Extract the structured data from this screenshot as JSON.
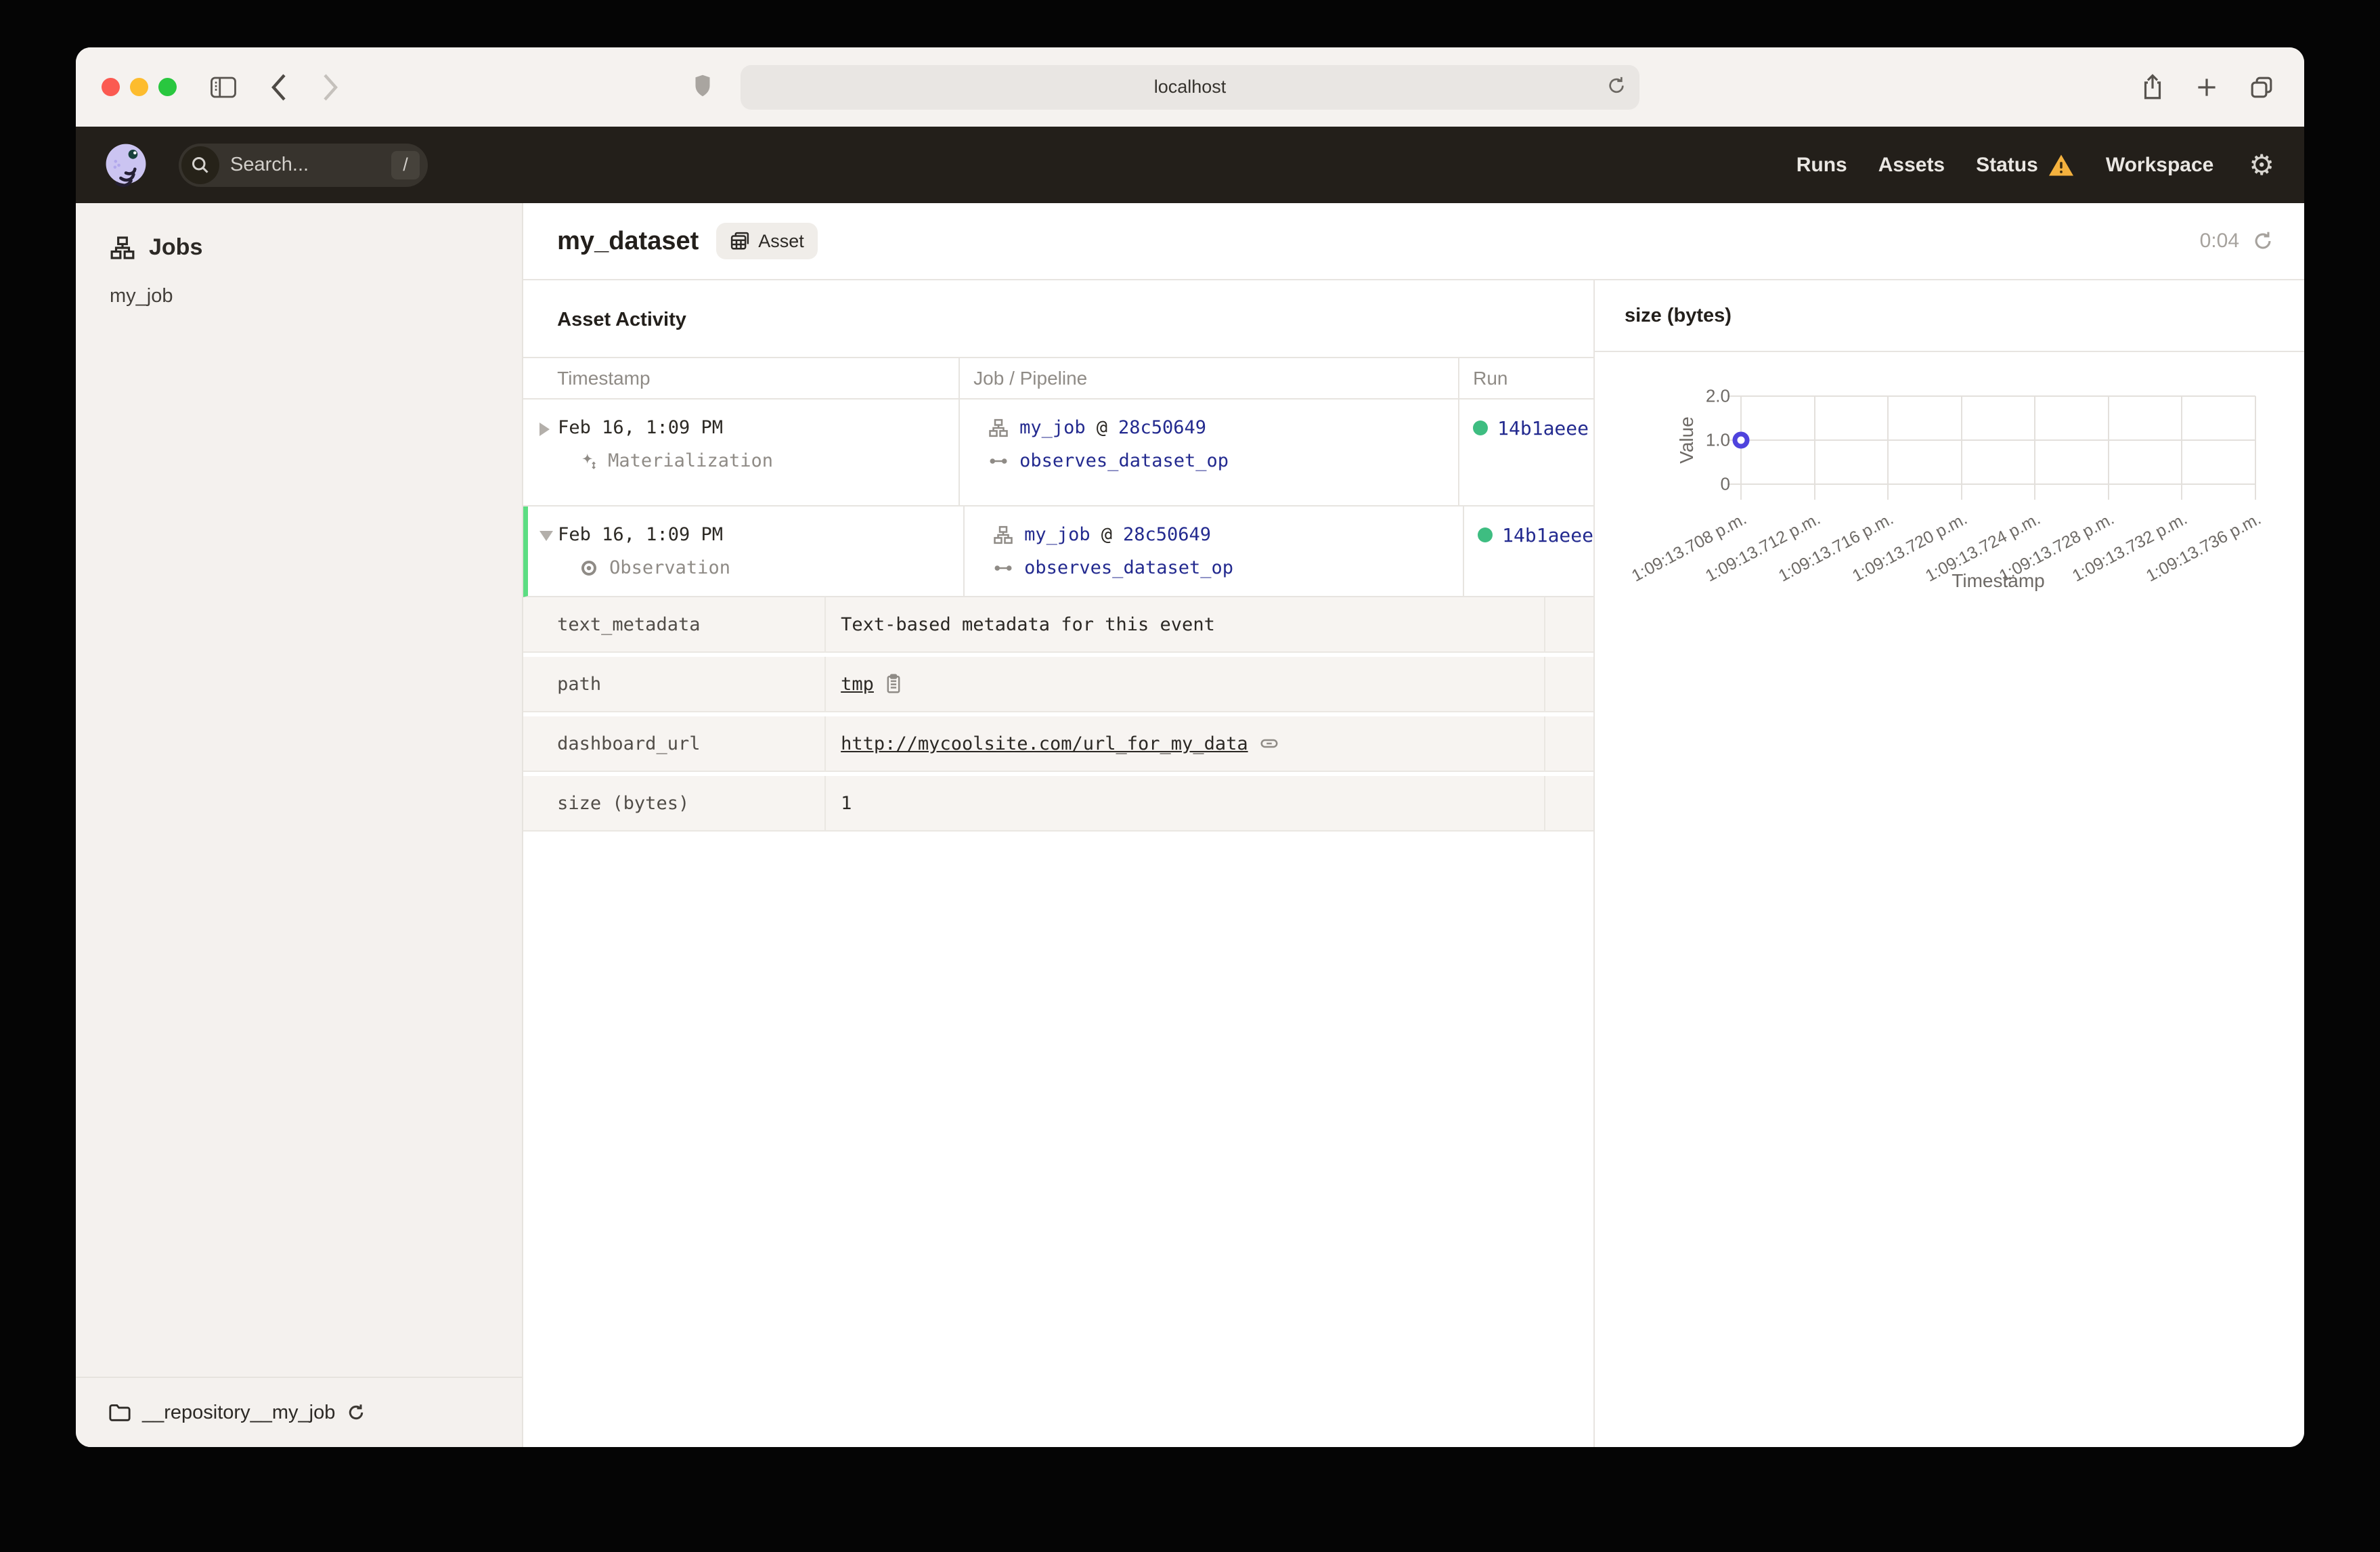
{
  "browser": {
    "address": "localhost"
  },
  "nav": {
    "search_placeholder": "Search...",
    "search_shortcut": "/",
    "links": [
      {
        "label": "Runs"
      },
      {
        "label": "Assets"
      },
      {
        "label": "Status"
      },
      {
        "label": "Workspace"
      }
    ]
  },
  "sidebar": {
    "section_title": "Jobs",
    "items": [
      {
        "label": "my_job"
      }
    ],
    "repository_label": "__repository__my_job"
  },
  "page": {
    "title": "my_dataset",
    "badge_label": "Asset",
    "refresh_timer": "0:04",
    "section_title": "Asset Activity"
  },
  "activity": {
    "headers": [
      "Timestamp",
      "Job / Pipeline",
      "Run"
    ],
    "rows": [
      {
        "timestamp": "Feb 16, 1:09 PM",
        "event_type": "Materialization",
        "job_name": "my_job",
        "separator": "@",
        "run_hash": "28c50649",
        "op_name": "observes_dataset_op",
        "run_id": "14b1aeee"
      },
      {
        "timestamp": "Feb 16, 1:09 PM",
        "event_type": "Observation",
        "job_name": "my_job",
        "separator": "@",
        "run_hash": "28c50649",
        "op_name": "observes_dataset_op",
        "run_id": "14b1aeee"
      }
    ],
    "metadata": [
      {
        "key": "text_metadata",
        "value": "Text-based metadata for this event"
      },
      {
        "key": "path",
        "value": "tmp"
      },
      {
        "key": "dashboard_url",
        "value": "http://mycoolsite.com/url_for_my_data"
      },
      {
        "key": "size (bytes)",
        "value": "1"
      }
    ]
  },
  "chart_data": {
    "type": "scatter",
    "title": "size (bytes)",
    "xlabel": "Timestamp",
    "ylabel": "Value",
    "ylim": [
      0,
      2
    ],
    "yticks": [
      0,
      1,
      2
    ],
    "ytick_labels": [
      "0",
      "1.0",
      "2.0"
    ],
    "x_tick_labels": [
      "1:09:13.708 p.m.",
      "1:09:13.712 p.m.",
      "1:09:13.716 p.m.",
      "1:09:13.720 p.m.",
      "1:09:13.724 p.m.",
      "1:09:13.728 p.m.",
      "1:09:13.732 p.m.",
      "1:09:13.736 p.m."
    ],
    "points": [
      {
        "x": "1:09:13.708 p.m.",
        "y": 1.0
      }
    ],
    "grid": true,
    "legend": false,
    "point_color": "#4f43dd"
  },
  "colors": {
    "accent": "#4f43dd",
    "link_navy": "#232a8f",
    "success_green": "#3ebd81",
    "row_highlight_green": "#5cdd82",
    "warning_yellow": "#f4b13e",
    "nav_bg": "#231f1a"
  }
}
